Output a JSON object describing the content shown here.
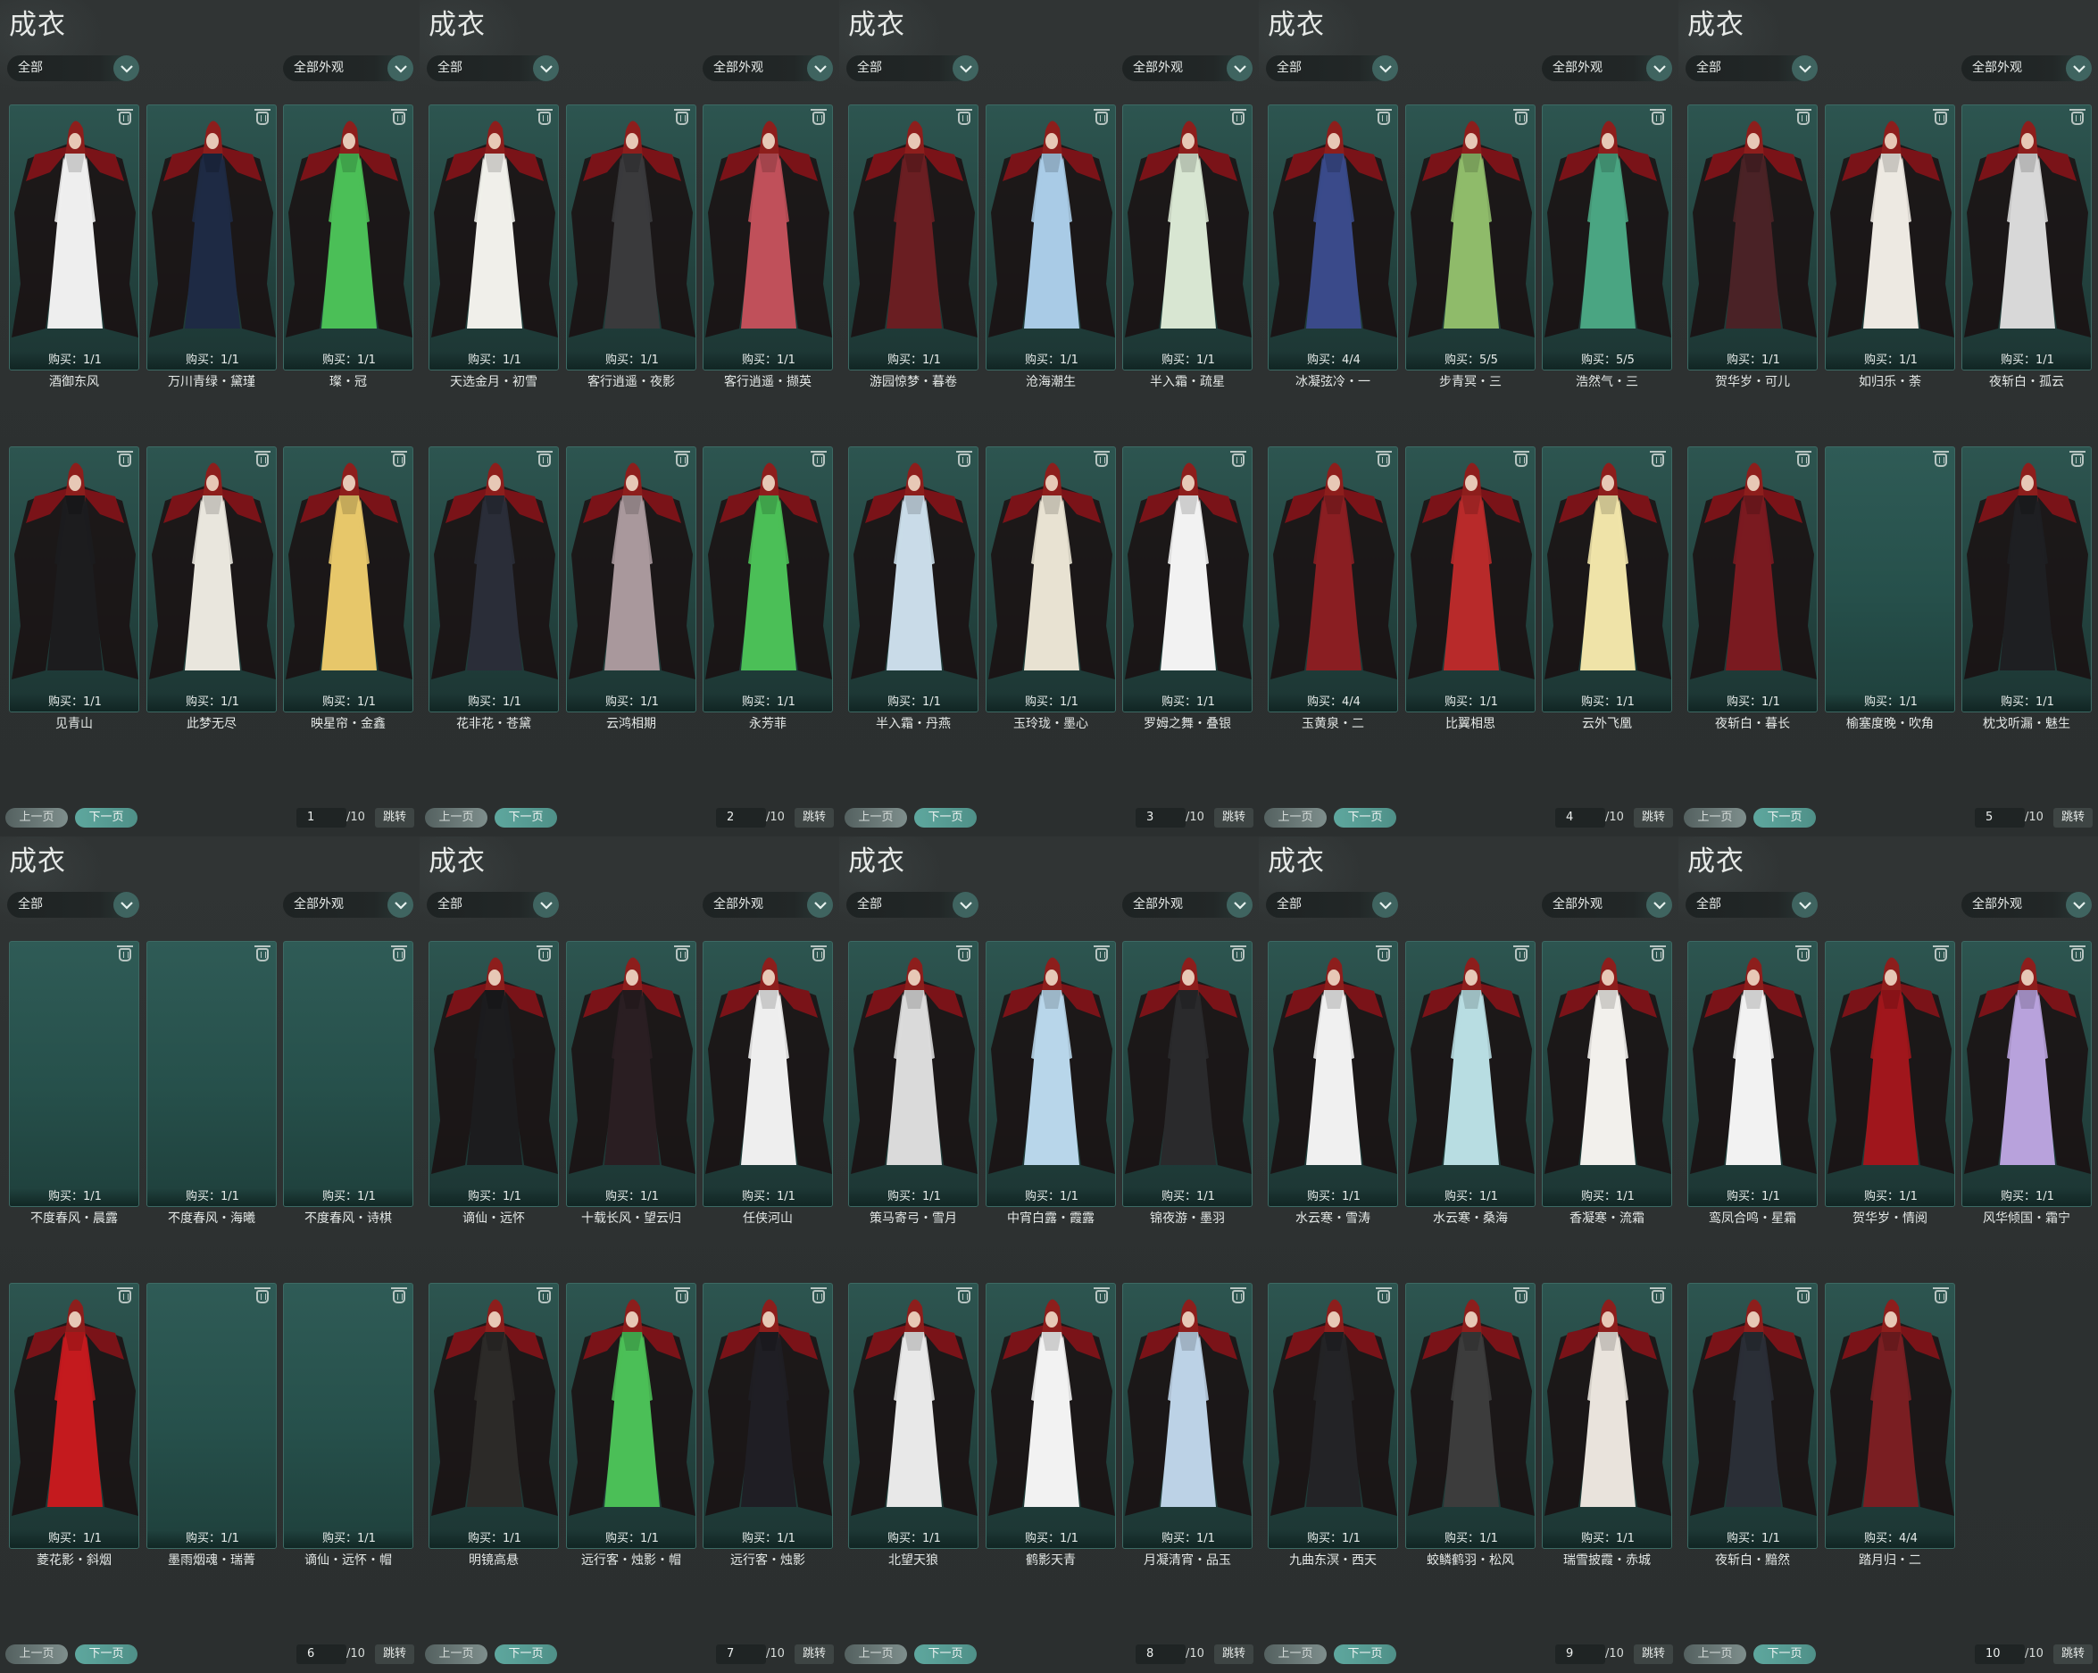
{
  "colors": {
    "accent": "#4f9088",
    "card_bg": "#26504b",
    "bg": "#2a2d2d"
  },
  "panels": [
    {
      "title": "成衣",
      "filter_category": "全部",
      "filter_look": "全部外观",
      "prev_label": "上一页",
      "next_label": "下一页",
      "page": "1",
      "total": "/10",
      "jump_label": "跳转",
      "items": [
        {
          "name": "酒御东风",
          "buy": "购买：1/1",
          "outfit": "#eeeeee"
        },
        {
          "name": "万川青绿・黛瑾",
          "buy": "购买：1/1",
          "outfit": "#1e2a44"
        },
        {
          "name": "璨・冠",
          "buy": "购买：1/1",
          "outfit": "#4bbf57"
        },
        {
          "name": "见青山",
          "buy": "购买：1/1",
          "outfit": "#1c1c1e"
        },
        {
          "name": "此梦无尽",
          "buy": "购买：1/1",
          "outfit": "#e9e6dd"
        },
        {
          "name": "映星帘・金鑫",
          "buy": "购买：1/1",
          "outfit": "#e7c76a"
        }
      ]
    },
    {
      "title": "成衣",
      "filter_category": "全部",
      "filter_look": "全部外观",
      "prev_label": "上一页",
      "next_label": "下一页",
      "page": "2",
      "total": "/10",
      "jump_label": "跳转",
      "items": [
        {
          "name": "天选金月・初雪",
          "buy": "购买：1/1",
          "outfit": "#f0efea"
        },
        {
          "name": "客行逍遥・夜影",
          "buy": "购买：1/1",
          "outfit": "#3a3a3c"
        },
        {
          "name": "客行逍遥・撷英",
          "buy": "购买：1/1",
          "outfit": "#c0505a"
        },
        {
          "name": "花非花・苍黛",
          "buy": "购买：1/1",
          "outfit": "#2a2d38"
        },
        {
          "name": "云鸿相期",
          "buy": "购买：1/1",
          "outfit": "#a9989c"
        },
        {
          "name": "永芳菲",
          "buy": "购买：1/1",
          "outfit": "#4bbf57"
        }
      ]
    },
    {
      "title": "成衣",
      "filter_category": "全部",
      "filter_look": "全部外观",
      "prev_label": "上一页",
      "next_label": "下一页",
      "page": "3",
      "total": "/10",
      "jump_label": "跳转",
      "items": [
        {
          "name": "游园惊梦・暮卷",
          "buy": "购买：1/1",
          "outfit": "#6a1e22"
        },
        {
          "name": "沧海潮生",
          "buy": "购买：1/1",
          "outfit": "#a9cbe6"
        },
        {
          "name": "半入霜・疏星",
          "buy": "购买：1/1",
          "outfit": "#d8e6d2"
        },
        {
          "name": "半入霜・丹燕",
          "buy": "购买：1/1",
          "outfit": "#c9dbe8"
        },
        {
          "name": "玉玲珑・墨心",
          "buy": "购买：1/1",
          "outfit": "#e8e2d2"
        },
        {
          "name": "罗姆之舞・叠银",
          "buy": "购买：1/1",
          "outfit": "#f2f2f2"
        }
      ]
    },
    {
      "title": "成衣",
      "filter_category": "全部",
      "filter_look": "全部外观",
      "prev_label": "上一页",
      "next_label": "下一页",
      "page": "4",
      "total": "/10",
      "jump_label": "跳转",
      "items": [
        {
          "name": "冰凝弦冷・一",
          "buy": "购买：4/4",
          "outfit": "#3a4a8a"
        },
        {
          "name": "步青冥・三",
          "buy": "购买：5/5",
          "outfit": "#8fbb6a"
        },
        {
          "name": "浩然气・三",
          "buy": "购买：5/5",
          "outfit": "#4aa582"
        },
        {
          "name": "玉黄泉・二",
          "buy": "购买：4/4",
          "outfit": "#8a1e22"
        },
        {
          "name": "比翼相思",
          "buy": "购买：1/1",
          "outfit": "#b82a2a"
        },
        {
          "name": "云外飞凰",
          "buy": "购买：1/1",
          "outfit": "#efe3a8"
        }
      ]
    },
    {
      "title": "成衣",
      "filter_category": "全部",
      "filter_look": "全部外观",
      "prev_label": "上一页",
      "next_label": "下一页",
      "page": "5",
      "total": "/10",
      "jump_label": "跳转",
      "items": [
        {
          "name": "贺华岁・可儿",
          "buy": "购买：1/1",
          "outfit": "#4a2226"
        },
        {
          "name": "如归乐・荼",
          "buy": "购买：1/1",
          "outfit": "#ede9e2"
        },
        {
          "name": "夜斩白・孤云",
          "buy": "购买：1/1",
          "outfit": "#d8d8d8"
        },
        {
          "name": "夜斩白・暮长",
          "buy": "购买：1/1",
          "outfit": "#7a1a20"
        },
        {
          "name": "榆塞度晚・吹角",
          "buy": "购买：1/1",
          "outfit": ""
        },
        {
          "name": "枕戈听漏・魅生",
          "buy": "购买：1/1",
          "outfit": "#1e1f22"
        }
      ]
    },
    {
      "title": "成衣",
      "filter_category": "全部",
      "filter_look": "全部外观",
      "prev_label": "上一页",
      "next_label": "下一页",
      "page": "6",
      "total": "/10",
      "jump_label": "跳转",
      "items": [
        {
          "name": "不度春风・晨露",
          "buy": "购买：1/1",
          "outfit": ""
        },
        {
          "name": "不度春风・海曦",
          "buy": "购买：1/1",
          "outfit": ""
        },
        {
          "name": "不度春风・诗棋",
          "buy": "购买：1/1",
          "outfit": ""
        },
        {
          "name": "菱花影・斜烟",
          "buy": "购买：1/1",
          "outfit": "#c41a1e"
        },
        {
          "name": "墨雨烟魂・瑞菁",
          "buy": "购买：1/1",
          "outfit": ""
        },
        {
          "name": "谪仙・远怀・帽",
          "buy": "购买：1/1",
          "outfit": ""
        }
      ]
    },
    {
      "title": "成衣",
      "filter_category": "全部",
      "filter_look": "全部外观",
      "prev_label": "上一页",
      "next_label": "下一页",
      "page": "7",
      "total": "/10",
      "jump_label": "跳转",
      "items": [
        {
          "name": "谪仙・远怀",
          "buy": "购买：1/1",
          "outfit": "#1c1c1e"
        },
        {
          "name": "十载长风・望云归",
          "buy": "购买：1/1",
          "outfit": "#2a1e22"
        },
        {
          "name": "任侠河山",
          "buy": "购买：1/1",
          "outfit": "#eeeeee"
        },
        {
          "name": "明镜高悬",
          "buy": "购买：1/1",
          "outfit": "#2c2a28"
        },
        {
          "name": "远行客・烛影・帽",
          "buy": "购买：1/1",
          "outfit": "#4bbf57"
        },
        {
          "name": "远行客・烛影",
          "buy": "购买：1/1",
          "outfit": "#1f1e24"
        }
      ]
    },
    {
      "title": "成衣",
      "filter_category": "全部",
      "filter_look": "全部外观",
      "prev_label": "上一页",
      "next_label": "下一页",
      "page": "8",
      "total": "/10",
      "jump_label": "跳转",
      "items": [
        {
          "name": "策马寄弓・雪月",
          "buy": "购买：1/1",
          "outfit": "#dadada"
        },
        {
          "name": "中宵白露・霞露",
          "buy": "购买：1/1",
          "outfit": "#b8d6ea"
        },
        {
          "name": "锦夜游・墨羽",
          "buy": "购买：1/1",
          "outfit": "#2a2a2c"
        },
        {
          "name": "北望天狼",
          "buy": "购买：1/1",
          "outfit": "#e8e8e8"
        },
        {
          "name": "鹤影天青",
          "buy": "购买：1/1",
          "outfit": "#f2f2f2"
        },
        {
          "name": "月凝清宵・品玉",
          "buy": "购买：1/1",
          "outfit": "#bcd2e6"
        }
      ]
    },
    {
      "title": "成衣",
      "filter_category": "全部",
      "filter_look": "全部外观",
      "prev_label": "上一页",
      "next_label": "下一页",
      "page": "9",
      "total": "/10",
      "jump_label": "跳转",
      "items": [
        {
          "name": "水云寒・雪涛",
          "buy": "购买：1/1",
          "outfit": "#f0f0f0"
        },
        {
          "name": "水云寒・桑海",
          "buy": "购买：1/1",
          "outfit": "#b8dde2"
        },
        {
          "name": "香凝寒・流霜",
          "buy": "购买：1/1",
          "outfit": "#f2f0ec"
        },
        {
          "name": "九曲东溟・西天",
          "buy": "购买：1/1",
          "outfit": "#232326"
        },
        {
          "name": "蛟鳞鹤羽・松风",
          "buy": "购买：1/1",
          "outfit": "#3c3c3c"
        },
        {
          "name": "瑞雪披霞・赤城",
          "buy": "购买：1/1",
          "outfit": "#e9e3dc"
        }
      ]
    },
    {
      "title": "成衣",
      "filter_category": "全部",
      "filter_look": "全部外观",
      "prev_label": "上一页",
      "next_label": "下一页",
      "page": "10",
      "total": "/10",
      "jump_label": "跳转",
      "items": [
        {
          "name": "鸾凤合鸣・星霜",
          "buy": "购买：1/1",
          "outfit": "#f2f2f2"
        },
        {
          "name": "贺华岁・情阅",
          "buy": "购买：1/1",
          "outfit": "#a0161c"
        },
        {
          "name": "风华倾国・霜宁",
          "buy": "购买：1/1",
          "outfit": "#b8a2dc"
        },
        {
          "name": "夜斩白・黯然",
          "buy": "购买：1/1",
          "outfit": "#2a2e36"
        },
        {
          "name": "踏月归・二",
          "buy": "购买：4/4",
          "outfit": "#7a1e22"
        }
      ]
    }
  ]
}
